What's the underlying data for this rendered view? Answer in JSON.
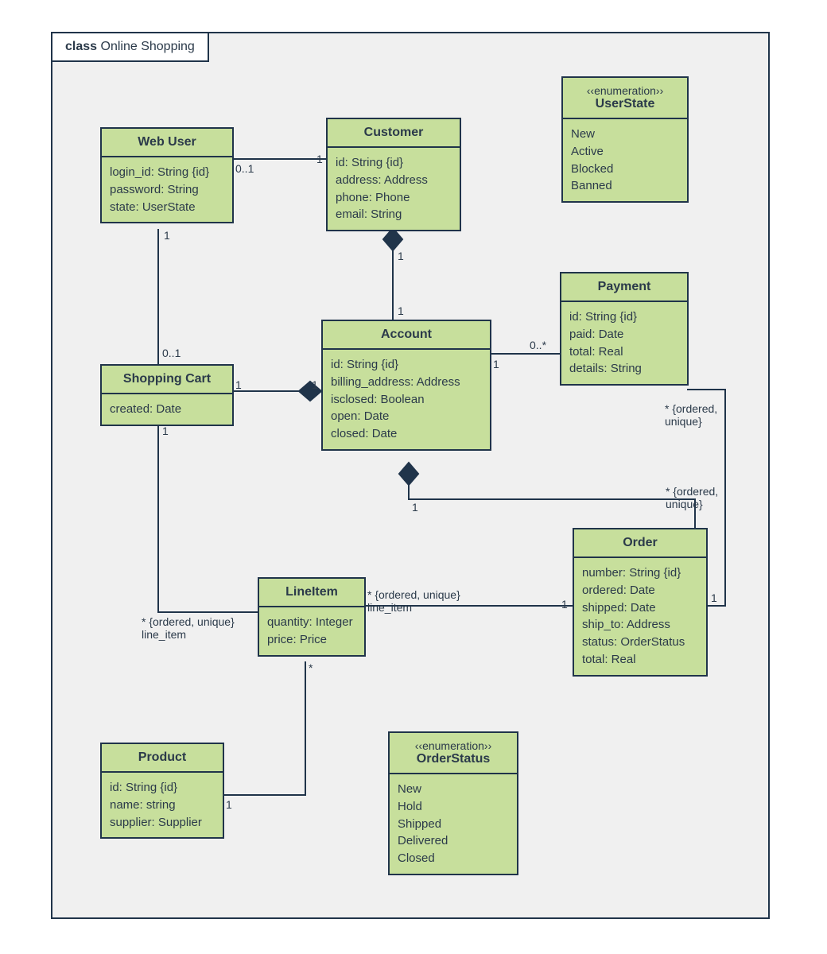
{
  "diagram": {
    "frame_prefix": "class",
    "frame_title": "Online Shopping",
    "classes": {
      "webuser": {
        "title": "Web User",
        "attrs": [
          "login_id: String {id}",
          "password: String",
          "state: UserState"
        ]
      },
      "customer": {
        "title": "Customer",
        "attrs": [
          "id: String {id}",
          "address: Address",
          "phone: Phone",
          "email: String"
        ]
      },
      "userstate": {
        "stereotype": "‹‹enumeration››",
        "title": "UserState",
        "attrs": [
          "New",
          "Active",
          "Blocked",
          "Banned"
        ]
      },
      "shoppingcart": {
        "title": "Shopping Cart",
        "attrs": [
          "created: Date"
        ]
      },
      "account": {
        "title": "Account",
        "attrs": [
          "id: String {id}",
          "billing_address: Address",
          "isclosed: Boolean",
          "open: Date",
          "closed: Date"
        ]
      },
      "payment": {
        "title": "Payment",
        "attrs": [
          "id: String {id}",
          "paid: Date",
          "total: Real",
          "details: String"
        ]
      },
      "lineitem": {
        "title": "LineItem",
        "attrs": [
          "quantity: Integer",
          "price: Price"
        ]
      },
      "order": {
        "title": "Order",
        "attrs": [
          "number: String {id}",
          "ordered: Date",
          "shipped: Date",
          "ship_to: Address",
          "status: OrderStatus",
          "total: Real"
        ]
      },
      "product": {
        "title": "Product",
        "attrs": [
          "id: String {id}",
          "name: string",
          "supplier: Supplier"
        ]
      },
      "orderstatus": {
        "stereotype": "‹‹enumeration››",
        "title": "OrderStatus",
        "attrs": [
          "New",
          "Hold",
          "Shipped",
          "Delivered",
          "Closed"
        ]
      }
    },
    "labels": {
      "webuser_customer_left": "0..1",
      "webuser_customer_right": "1",
      "webuser_cart_top": "1",
      "webuser_cart_bottom": "0..1",
      "customer_account_top": "1",
      "customer_account_bottom": "1",
      "cart_account_left": "1",
      "cart_account_right": "1",
      "account_payment_left": "1",
      "account_payment_right": "0..*",
      "account_order_left": "1",
      "account_order_right": "* {ordered,\nunique}",
      "payment_order_top": "* {ordered,\nunique}",
      "payment_order_bottom": "1",
      "cart_lineitem_top": "1",
      "cart_lineitem_bottom": "* {ordered, unique}\nline_item",
      "lineitem_order_left": "* {ordered, unique}\nline_item",
      "lineitem_order_right": "1",
      "lineitem_product_top": "*",
      "lineitem_product_bottom": "1"
    }
  }
}
